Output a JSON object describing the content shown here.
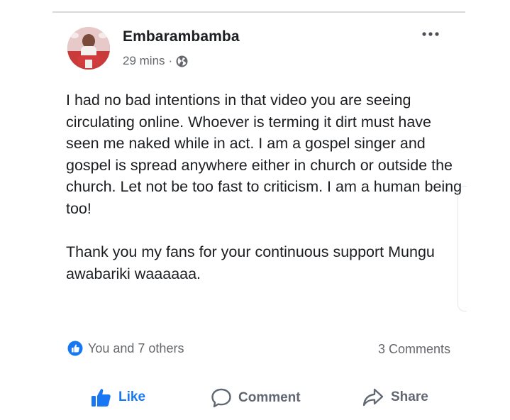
{
  "post": {
    "author": "Embarambamba",
    "time": "29 mins",
    "separator": "·",
    "privacy_icon": "globe-icon",
    "menu_icon": "more-horizontal-icon",
    "paragraphs": [
      "I had no bad intentions in that video you are seeing circulating online. Whoever is terming it dirt must have seen me naked while in act. I am a gospel singer and gospel is spread anywhere either in church or outside the church. Let not be too fast to criticism. I am a human being too!",
      "Thank you my fans for your continuous support Mungu awabariki waaaaaa."
    ]
  },
  "reactions": {
    "icon": "like-reaction-icon",
    "text": "You and 7 others",
    "comments": "3 Comments"
  },
  "actions": {
    "like": "Like",
    "comment": "Comment",
    "share": "Share"
  },
  "colors": {
    "brand_blue": "#1877f2",
    "text_primary": "#1c1e21",
    "text_secondary": "#65676b",
    "action_grey": "#606770"
  }
}
